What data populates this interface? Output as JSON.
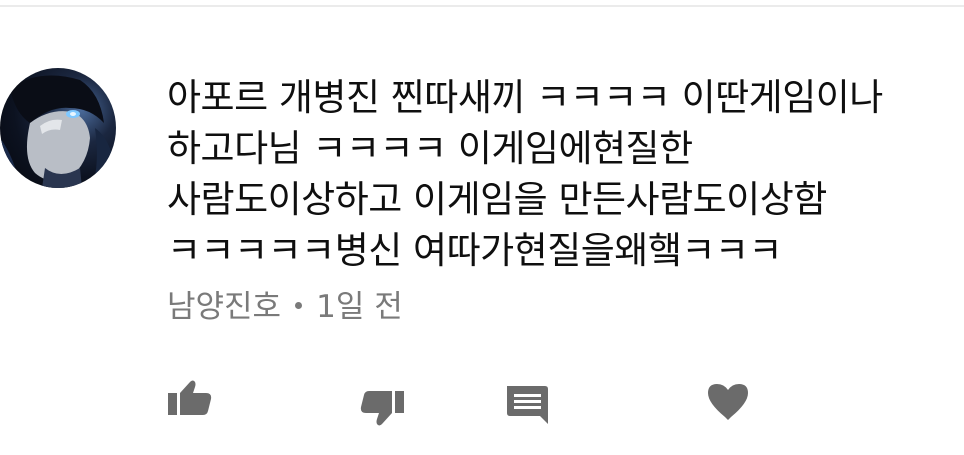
{
  "comment": {
    "lines": [
      "아포르 개병진 찐따새끼 ㅋㅋㅋㅋ 이딴게임이나",
      "하고다님 ㅋㅋㅋㅋ 이게임에현질한",
      "사람도이상하고 이게임을 만든사람도이상함",
      "ㅋㅋㅋㅋㅋ병신 여따가현질을왜햌ㅋㅋㅋ"
    ],
    "author": "남양진호",
    "time": "1일 전"
  },
  "actions": {
    "like_icon": "thumbs-up-icon",
    "dislike_icon": "thumbs-down-icon",
    "reply_icon": "comment-icon",
    "heart_icon": "heart-icon"
  },
  "colors": {
    "text": "#0f0f0f",
    "meta": "#7a7a7a",
    "icon": "#6b6b6b"
  }
}
